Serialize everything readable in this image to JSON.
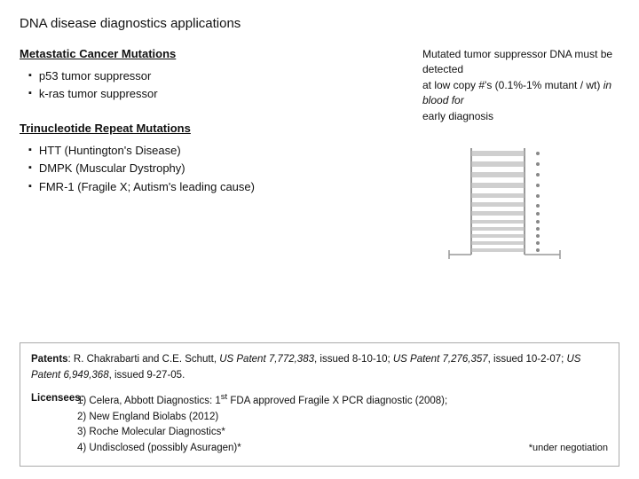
{
  "page": {
    "title": "DNA disease diagnostics applications"
  },
  "section1": {
    "title": "Metastatic Cancer Mutations",
    "bullets": [
      "p53 tumor suppressor",
      "k-ras tumor suppressor"
    ],
    "description_line1": "Mutated tumor suppressor DNA must be detected",
    "description_line2": "at low copy #'s (0.1%-1% mutant / wt) in blood for",
    "description_line3": "early diagnosis"
  },
  "section2": {
    "title": "Trinucleotide Repeat Mutations",
    "bullets": [
      "HTT (Huntington's Disease)",
      "DMPK (Muscular Dystrophy)",
      "FMR-1 (Fragile X; Autism's leading cause)"
    ]
  },
  "footer": {
    "patents_label": "Patents:",
    "patents_text": " R. Chakrabarti and C.E. Schutt, ",
    "patents_detail": "US Patent 7,772,383, issued 8-10-10; US Patent 7,276,357, issued 10-2-07;  US Patent 6,949,368, issued 9-27-05.",
    "licensees_label": "Licensees:",
    "licensees_items": [
      "1) Celera, Abbott Diagnostics: 1st FDA approved Fragile X PCR diagnostic (2008);",
      "2) New England Biolabs (2012)",
      "3) Roche Molecular Diagnostics*",
      "4) Undisclosed (possibly Asuragen)*"
    ],
    "under_negotiation": "*under negotiation"
  }
}
